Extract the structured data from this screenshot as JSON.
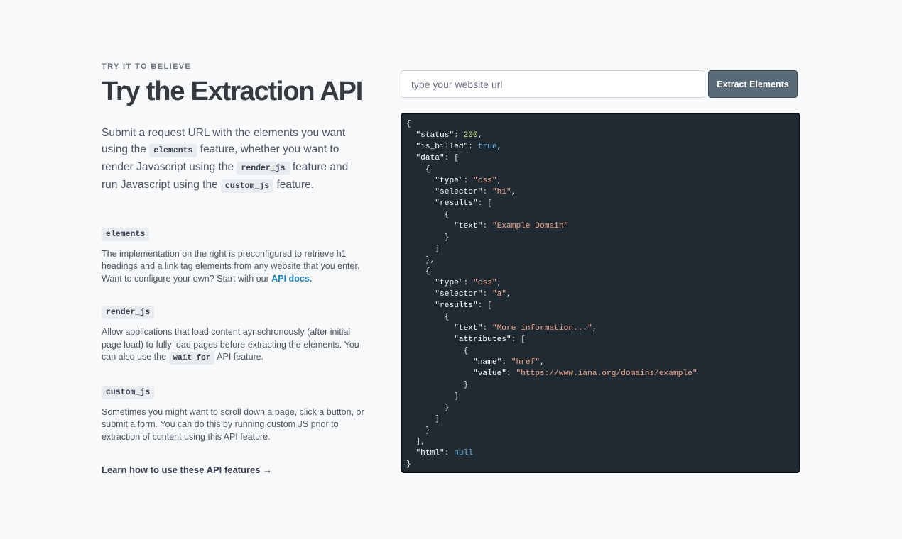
{
  "eyebrow": "TRY IT TO BELIEVE",
  "title": "Try the Extraction API",
  "lead": {
    "p1": "Submit a request URL with the elements you want using the",
    "code1": "elements",
    "p2": "feature, whether you want to render Javascript using the",
    "code2": "render_js",
    "p3": "feature and run Javascript using the",
    "code3": "custom_js",
    "p4": "feature."
  },
  "features": [
    {
      "tag": "elements",
      "text": "The implementation on the right is preconfigured to retrieve h1 headings and a link tag elements from any website that you enter. Want to configure your own? Start with our",
      "link": "API docs."
    },
    {
      "tag": "render_js",
      "text_before": "Allow applications that load content aynschronously (after initial page load) to fully load pages before extracting the elements. You can also use the",
      "code": "wait_for",
      "text_after": "API feature."
    },
    {
      "tag": "custom_js",
      "text": "Sometimes you might want to scroll down a page, click a button, or submit a form. You can do this by running custom JS prior to extraction of content using this API feature."
    }
  ],
  "learn_link": "Learn how to use these API features →",
  "url_input": {
    "placeholder": "type your website url",
    "value": ""
  },
  "extract_button": "Extract Elements",
  "response": {
    "status": 200,
    "is_billed": true,
    "data": [
      {
        "type": "css",
        "selector": "h1",
        "results": [
          {
            "text": "Example Domain"
          }
        ]
      },
      {
        "type": "css",
        "selector": "a",
        "results": [
          {
            "text": "More information...",
            "attributes": [
              {
                "name": "href",
                "value": "https://www.iana.org/domains/example"
              }
            ]
          }
        ]
      }
    ],
    "html": null
  },
  "colors": {
    "key": "#ffffff",
    "string": "#f4a58a",
    "number": "#d5ea8e",
    "literal": "#6fb3e0",
    "panel": "#1f2a33",
    "button": "#5a6b78",
    "link": "#1a7fb5"
  }
}
